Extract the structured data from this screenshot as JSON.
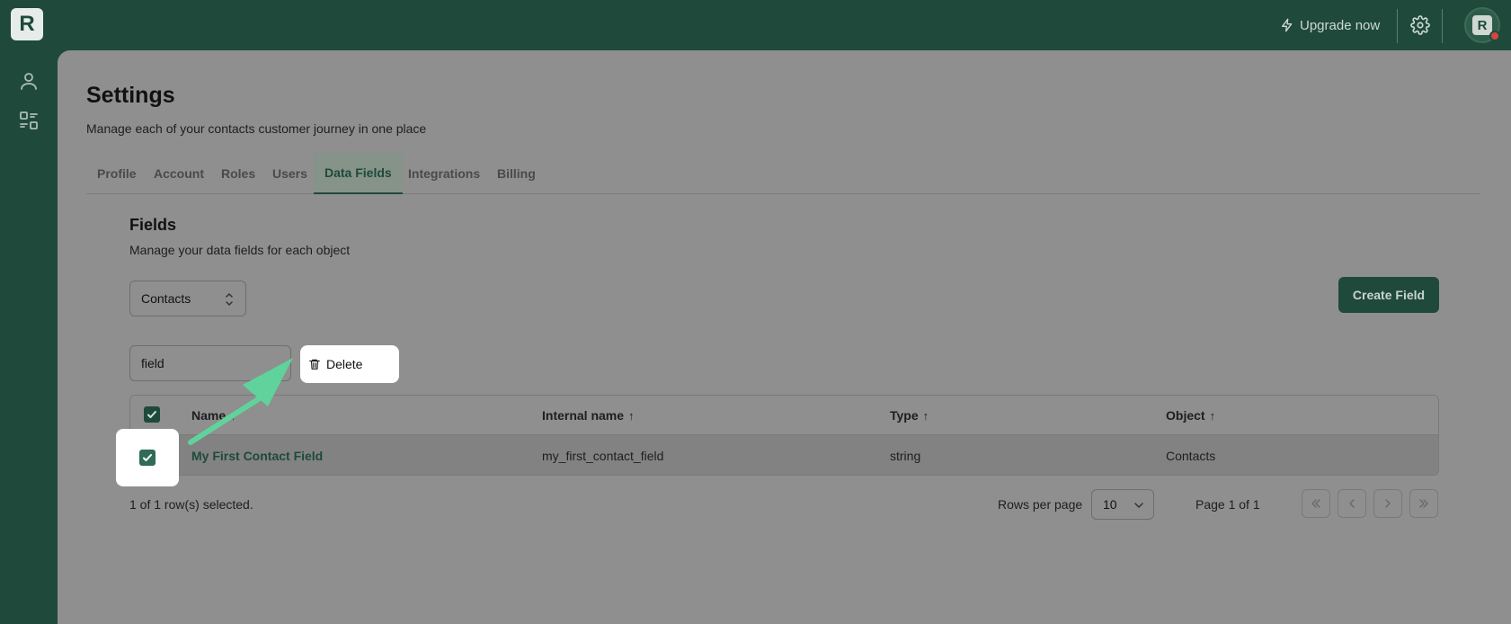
{
  "topbar": {
    "logo_letter": "R",
    "upgrade_label": "Upgrade now",
    "avatar_letter": "R"
  },
  "page": {
    "title": "Settings",
    "subtitle": "Manage each of your contacts customer journey in one place"
  },
  "tabs": [
    {
      "label": "Profile"
    },
    {
      "label": "Account"
    },
    {
      "label": "Roles"
    },
    {
      "label": "Users"
    },
    {
      "label": "Data Fields",
      "active": true
    },
    {
      "label": "Integrations"
    },
    {
      "label": "Billing"
    }
  ],
  "fields": {
    "title": "Fields",
    "subtitle": "Manage your data fields for each object",
    "object_select": "Contacts",
    "create_label": "Create Field",
    "filter_value": "field",
    "delete_label": "Delete"
  },
  "table": {
    "headers": [
      "Name",
      "Internal name",
      "Type",
      "Object"
    ],
    "sort_glyph": "↑",
    "rows": [
      {
        "name": "My First Contact Field",
        "internal_name": "my_first_contact_field",
        "type": "string",
        "object": "Contacts",
        "checked": true
      }
    ]
  },
  "footer": {
    "selected_text": "1 of 1 row(s) selected.",
    "rows_per_page_label": "Rows per page",
    "rows_per_page_value": "10",
    "page_label": "Page 1 of 1"
  },
  "colors": {
    "brand": "#1f4a3b",
    "annotation_arrow": "#5fd39b"
  }
}
